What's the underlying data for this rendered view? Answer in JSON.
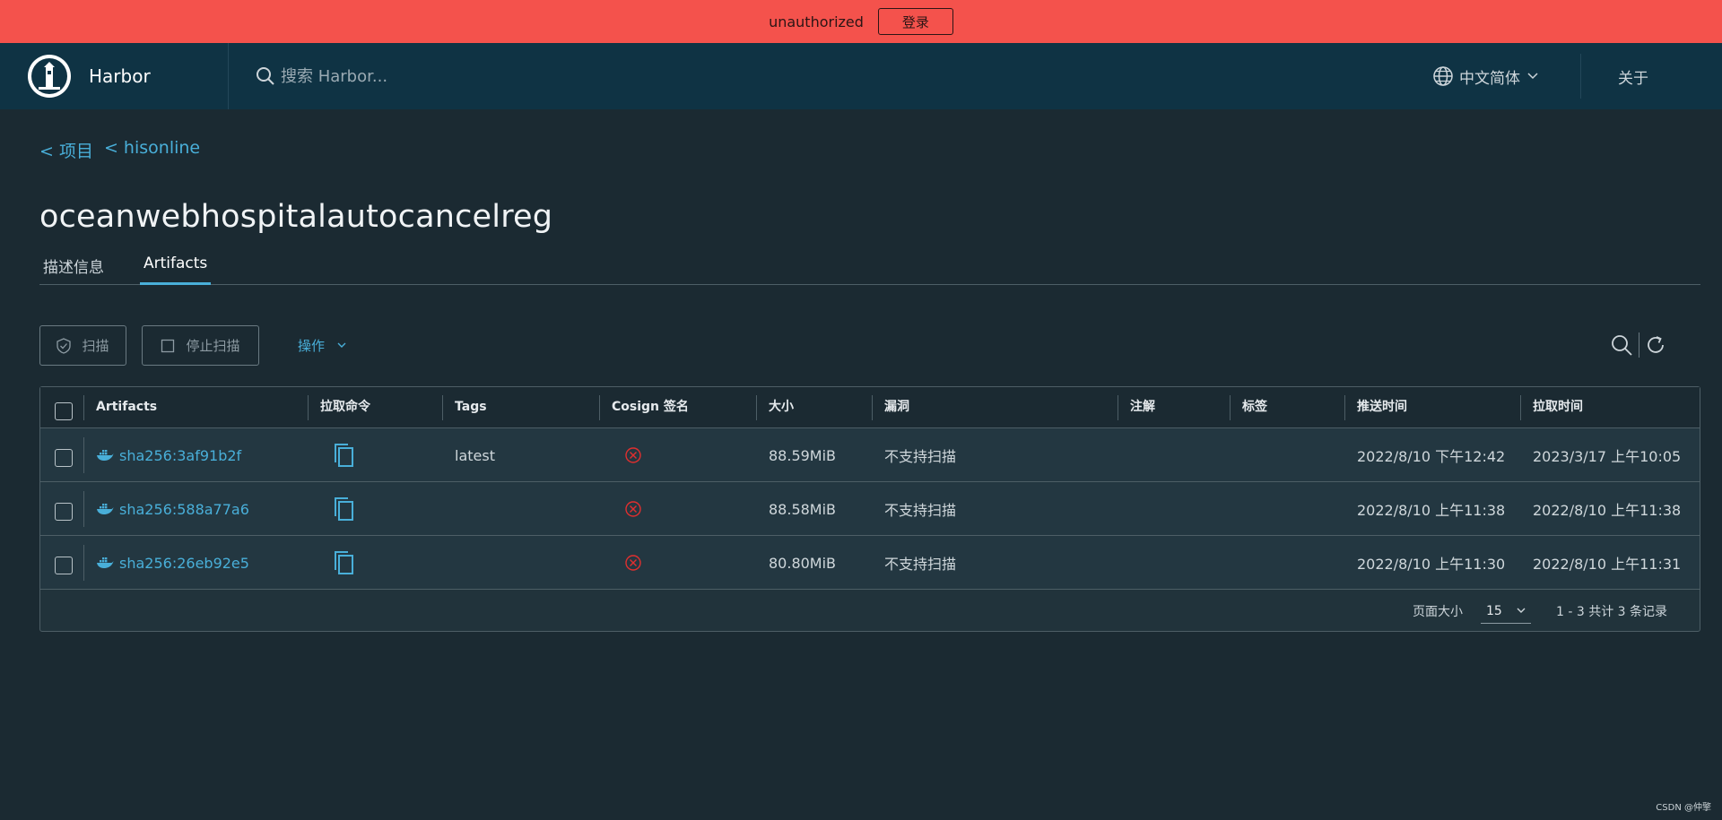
{
  "banner": {
    "message": "unauthorized",
    "login_label": "登录"
  },
  "header": {
    "brand": "Harbor",
    "search_placeholder": "搜索 Harbor...",
    "language": "中文简体",
    "about": "关于"
  },
  "breadcrumb": {
    "projects": "< 项目",
    "project": "< hisonline"
  },
  "page_title": "oceanwebhospitalautocancelreg",
  "tabs": [
    {
      "label": "描述信息",
      "active": false
    },
    {
      "label": "Artifacts",
      "active": true
    }
  ],
  "toolbar": {
    "scan_label": "扫描",
    "stop_scan_label": "停止扫描",
    "actions_label": "操作"
  },
  "table": {
    "columns": [
      "Artifacts",
      "拉取命令",
      "Tags",
      "Cosign 签名",
      "大小",
      "漏洞",
      "注解",
      "标签",
      "推送时间",
      "拉取时间"
    ],
    "rows": [
      {
        "artifact": "sha256:3af91b2f",
        "tags": "latest",
        "size": "88.59MiB",
        "vulnerabilities": "不支持扫描",
        "push_time": "2022/8/10 下午12:42",
        "pull_time": "2023/3/17 上午10:05"
      },
      {
        "artifact": "sha256:588a77a6",
        "tags": "",
        "size": "88.58MiB",
        "vulnerabilities": "不支持扫描",
        "push_time": "2022/8/10 上午11:38",
        "pull_time": "2022/8/10 上午11:38"
      },
      {
        "artifact": "sha256:26eb92e5",
        "tags": "",
        "size": "80.80MiB",
        "vulnerabilities": "不支持扫描",
        "push_time": "2022/8/10 上午11:30",
        "pull_time": "2022/8/10 上午11:31"
      }
    ],
    "footer": {
      "page_size_label": "页面大小",
      "page_size": "15",
      "range_text": "1 - 3 共计 3 条记录"
    }
  },
  "watermark": "CSDN @仲擎",
  "colors": {
    "banner": "#f4524c",
    "header": "#0f3344",
    "background": "#1b2a32",
    "accent": "#49afd9",
    "error": "#e02f2f"
  },
  "icons": [
    "harbor-logo-icon",
    "search-icon",
    "globe-icon",
    "chevron-down-icon",
    "shield-icon",
    "refresh-icon",
    "copy-icon",
    "docker-icon",
    "error-circle-icon"
  ]
}
